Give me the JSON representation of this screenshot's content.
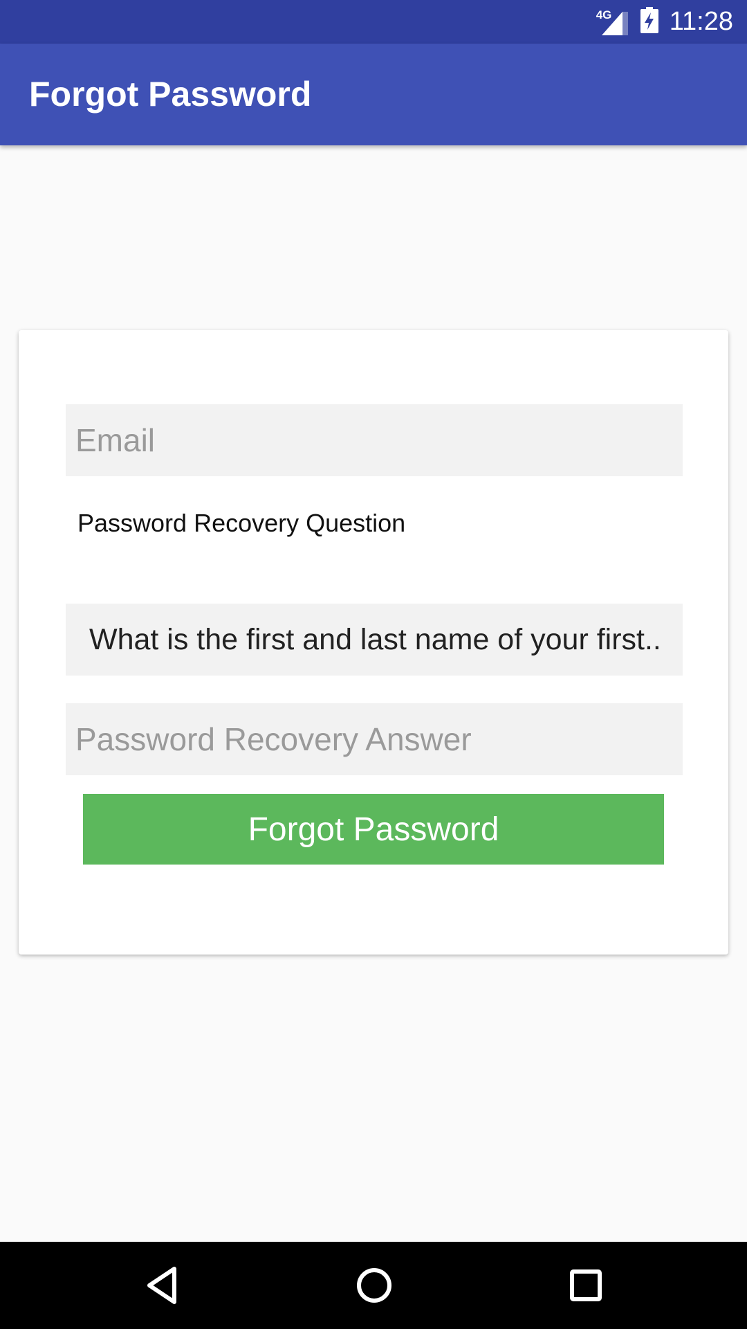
{
  "status_bar": {
    "network_label": "4G",
    "time": "11:28",
    "icons": [
      "signal-icon",
      "battery-charging-icon"
    ]
  },
  "app_bar": {
    "title": "Forgot Password"
  },
  "form": {
    "email_placeholder": "Email",
    "question_label": "Password Recovery Question",
    "question_value": "What is the first and last name of your first..",
    "answer_placeholder": "Password Recovery Answer",
    "submit_label": "Forgot Password"
  },
  "nav_bar": {
    "icons": [
      "back-icon",
      "home-icon",
      "recents-icon"
    ]
  },
  "colors": {
    "status_bar": "#303f9f",
    "app_bar": "#3f51b5",
    "button": "#5cb85c",
    "field_background": "#f2f2f2",
    "page_background": "#fafafa"
  }
}
